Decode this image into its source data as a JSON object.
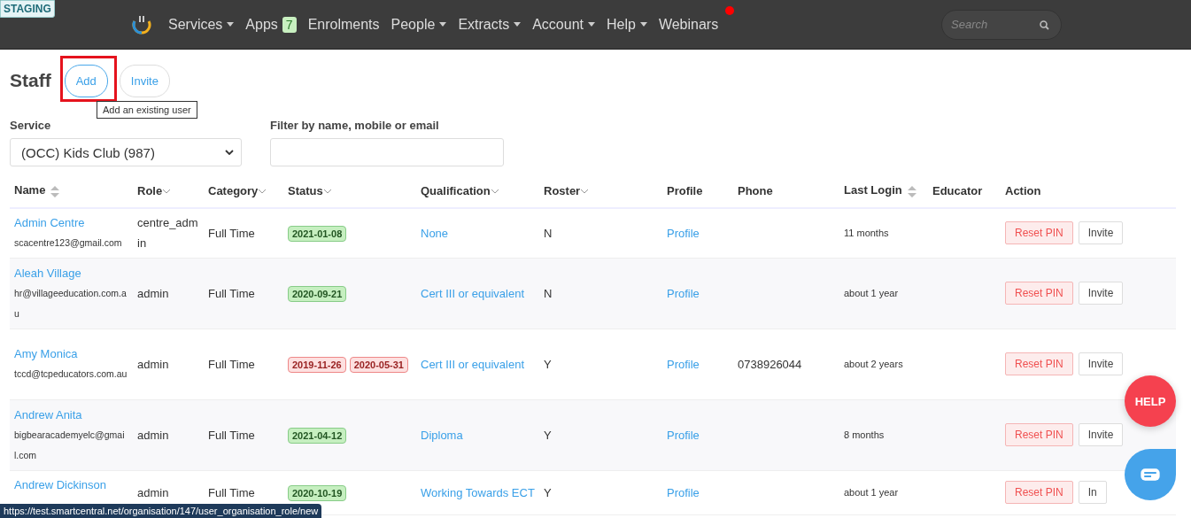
{
  "badge": "STAGING",
  "nav": {
    "items": [
      {
        "label": "Services",
        "dropdown": true
      },
      {
        "label": "Apps",
        "dropdown": false,
        "count": "7"
      },
      {
        "label": "Enrolments",
        "dropdown": false
      },
      {
        "label": "People",
        "dropdown": true
      },
      {
        "label": "Extracts",
        "dropdown": true
      },
      {
        "label": "Account",
        "dropdown": true
      },
      {
        "label": "Help",
        "dropdown": true
      },
      {
        "label": "Webinars",
        "dropdown": false,
        "notify": true
      }
    ],
    "search": {
      "placeholder": "Search"
    }
  },
  "page": {
    "title": "Staff",
    "buttons": [
      {
        "label": "Add",
        "highlighted": true
      },
      {
        "label": "Invite",
        "highlighted": false
      }
    ],
    "tooltip": "Add an existing user"
  },
  "filters": {
    "service": {
      "label": "Service",
      "value": "(OCC) Kids Club (987)"
    },
    "filter": {
      "label": "Filter by name, mobile or email"
    }
  },
  "table": {
    "columns": [
      {
        "label": "Name",
        "sort_arrows": true,
        "sort_caret": false
      },
      {
        "label": "Role",
        "sort_arrows": false,
        "sort_caret": true
      },
      {
        "label": "Category",
        "sort_arrows": false,
        "sort_caret": true
      },
      {
        "label": "Status",
        "sort_arrows": false,
        "sort_caret": true
      },
      {
        "label": "Qualification",
        "sort_arrows": false,
        "sort_caret": true
      },
      {
        "label": "Roster",
        "sort_arrows": false,
        "sort_caret": true
      },
      {
        "label": "Profile",
        "sort_arrows": false,
        "sort_caret": false
      },
      {
        "label": "Phone",
        "sort_arrows": false,
        "sort_caret": false
      },
      {
        "label": "Last Login",
        "sort_arrows": true,
        "sort_caret": false
      },
      {
        "label": "Educator",
        "sort_arrows": false,
        "sort_caret": false
      },
      {
        "label": "Action",
        "sort_arrows": false,
        "sort_caret": false
      }
    ],
    "rows": [
      {
        "name": "Admin Centre",
        "email": "scacentre123@gmail.com",
        "role": "centre_admin",
        "category": "Full Time",
        "status": [
          {
            "date": "2021-01-08",
            "kind": "valid"
          }
        ],
        "qualification": "None",
        "roster": "N",
        "profile": "Profile",
        "last_login": "11 months",
        "actions": [
          "Reset PIN",
          "Invite"
        ]
      },
      {
        "name": "Aleah Village",
        "email": "hr@villageeducation.com.au",
        "role": "admin",
        "category": "Full Time",
        "status": [
          {
            "date": "2020-09-21",
            "kind": "valid"
          }
        ],
        "qualification": "Cert III or equivalent",
        "roster": "N",
        "profile": "Profile",
        "last_login": "about 1 year",
        "actions": [
          "Reset PIN",
          "Invite"
        ]
      },
      {
        "name": "Amy Monica",
        "email": "tccd@tcpeducators.com.au",
        "role": "admin",
        "category": "Full Time",
        "status": [
          {
            "date": "2019-11-26",
            "kind": "expired"
          },
          {
            "date": "2020-05-31",
            "kind": "expired"
          }
        ],
        "qualification": "Cert III or equivalent",
        "roster": "Y",
        "profile": "Profile",
        "phone": "0738926044",
        "last_login": "about 2 years",
        "actions": [
          "Reset PIN",
          "Invite"
        ]
      },
      {
        "name": "Andrew Anita",
        "email": "bigbearacademyelc@gmail.com",
        "role": "admin",
        "category": "Full Time",
        "status": [
          {
            "date": "2021-04-12",
            "kind": "valid"
          }
        ],
        "qualification": "Diploma",
        "roster": "Y",
        "profile": "Profile",
        "last_login": "8 months",
        "actions": [
          "Reset PIN",
          "Invite"
        ]
      },
      {
        "name": "Andrew Dickinson",
        "role": "admin",
        "category": "Full Time",
        "status": [
          {
            "date": "2020-10-19",
            "kind": "valid"
          }
        ],
        "qualification": "Working Towards ECT",
        "roster": "Y",
        "profile": "Profile",
        "last_login": "about 1 year",
        "actions": [
          "Reset PIN",
          "In"
        ]
      }
    ]
  },
  "help": "HELP",
  "status_bar": "https://test.smartcentral.net/organisation/147/user_organisation_role/new"
}
